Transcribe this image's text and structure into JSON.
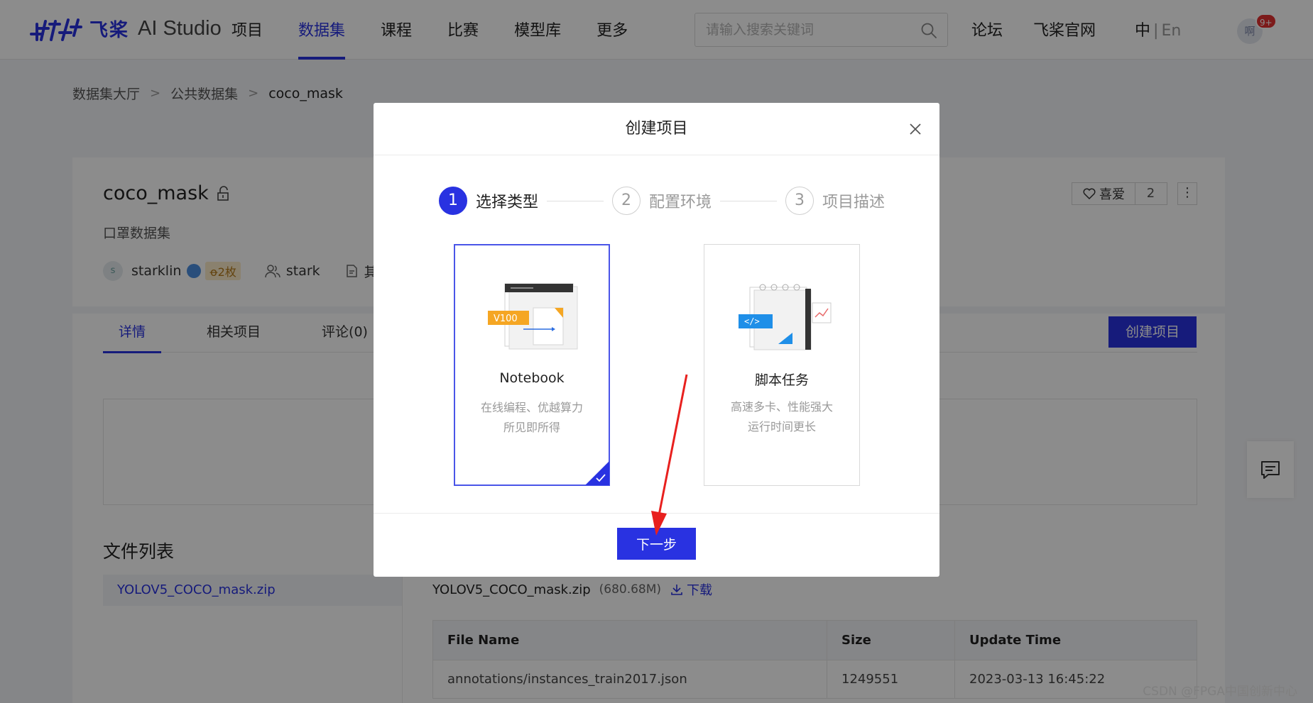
{
  "app": {
    "logo_cn": "飞桨",
    "logo_en": "AI Studio"
  },
  "nav": {
    "items": [
      {
        "label": "项目",
        "active": false
      },
      {
        "label": "数据集",
        "active": true
      },
      {
        "label": "课程",
        "active": false
      },
      {
        "label": "比赛",
        "active": false
      },
      {
        "label": "模型库",
        "active": false
      },
      {
        "label": "更多",
        "active": false
      }
    ],
    "search_placeholder": "请输入搜索关键词",
    "forum": "论坛",
    "official": "飞桨官网",
    "lang_cn": "中",
    "lang_sep": "|",
    "lang_en": "En",
    "avatar_text": "啊",
    "notification_badge": "9+"
  },
  "breadcrumb": {
    "items": [
      "数据集大厅",
      "公共数据集",
      "coco_mask"
    ],
    "separator": ">"
  },
  "dataset": {
    "title": "coco_mask",
    "description": "口罩数据集",
    "author_avatar": "s",
    "author": "starklin",
    "coins": "ꝋ2枚",
    "collaborator": "stark",
    "license_partial": "其",
    "like_label": "喜爱",
    "like_count": "2",
    "more_label": "⋮"
  },
  "tabs": {
    "items": [
      {
        "label": "详情",
        "active": true
      },
      {
        "label": "相关项目",
        "active": false
      },
      {
        "label": "评论(0)",
        "active": false
      }
    ],
    "create_project": "创建项目"
  },
  "files": {
    "section_title": "文件列表",
    "list": [
      "YOLOV5_COCO_mask.zip"
    ],
    "selected_name": "YOLOV5_COCO_mask.zip",
    "selected_size": "(680.68M)",
    "download_label": "下载",
    "table": {
      "headers": [
        "File Name",
        "Size",
        "Update Time"
      ],
      "rows": [
        [
          "annotations/instances_train2017.json",
          "1249551",
          "2023-03-13 16:45:22"
        ]
      ]
    }
  },
  "modal": {
    "title": "创建项目",
    "steps": [
      {
        "num": "1",
        "label": "选择类型",
        "active": true
      },
      {
        "num": "2",
        "label": "配置环境",
        "active": false
      },
      {
        "num": "3",
        "label": "项目描述",
        "active": false
      }
    ],
    "types": [
      {
        "title": "Notebook",
        "desc_line1": "在线编程、优越算力",
        "desc_line2": "所见即所得",
        "selected": true,
        "illus_tag": "V100"
      },
      {
        "title": "脚本任务",
        "desc_line1": "高速多卡、性能强大",
        "desc_line2": "运行时间更长",
        "selected": false,
        "illus_tag": "</>"
      }
    ],
    "next_button": "下一步"
  },
  "watermark": "CSDN @FPGA中国创新中心",
  "colors": {
    "brand": "#2932e1",
    "annotation_arrow": "#e8201e"
  },
  "icons": {
    "search": "search-icon",
    "close": "close-icon",
    "lock": "lock-icon",
    "heart": "heart-icon",
    "download": "download-icon",
    "feedback": "chat-icon"
  }
}
